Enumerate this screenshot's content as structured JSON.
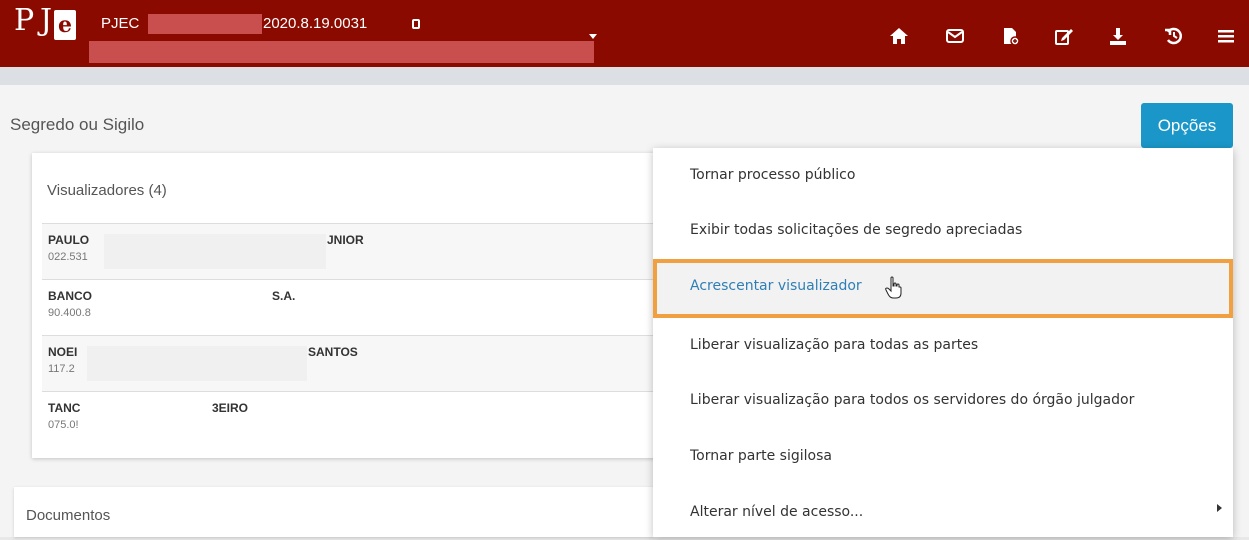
{
  "header": {
    "logo_text_p": "P",
    "logo_text_j": "J",
    "logo_text_e": "e",
    "process_prefix": "PJEC",
    "process_number": "2020.8.19.0031",
    "icons": [
      "home-icon",
      "mail-icon",
      "document-add-icon",
      "edit-icon",
      "download-icon",
      "history-icon",
      "menu-icon"
    ]
  },
  "page": {
    "title": "Segredo ou Sigilo",
    "options_button": "Opções"
  },
  "viewers": {
    "title": "Visualizadores (4)",
    "rows": [
      {
        "name_start": "PAULO",
        "name_end": "JNIOR",
        "doc": "022.531"
      },
      {
        "name_start": "BANCO",
        "name_end": "S.A.",
        "doc": "90.400.8"
      },
      {
        "name_start": "NOEI",
        "name_end": "SANTOS",
        "doc": "117.2"
      },
      {
        "name_start": "TANC",
        "name_end": "3EIRO",
        "doc": "075.0!"
      }
    ]
  },
  "documents": {
    "title": "Documentos"
  },
  "options_menu": {
    "items": [
      "Tornar processo público",
      "Exibir todas solicitações de segredo apreciadas",
      "Acrescentar visualizador",
      "Liberar visualização para todas as partes",
      "Liberar visualização para todos os servidores do órgão julgador",
      "Tornar parte sigilosa",
      "Alterar nível de acesso..."
    ],
    "active_index": 2
  },
  "colors": {
    "header_bg": "#8b0a00",
    "button_bg": "#1a96c8",
    "highlight_border": "#f0a040",
    "active_text": "#2f7fb5"
  }
}
